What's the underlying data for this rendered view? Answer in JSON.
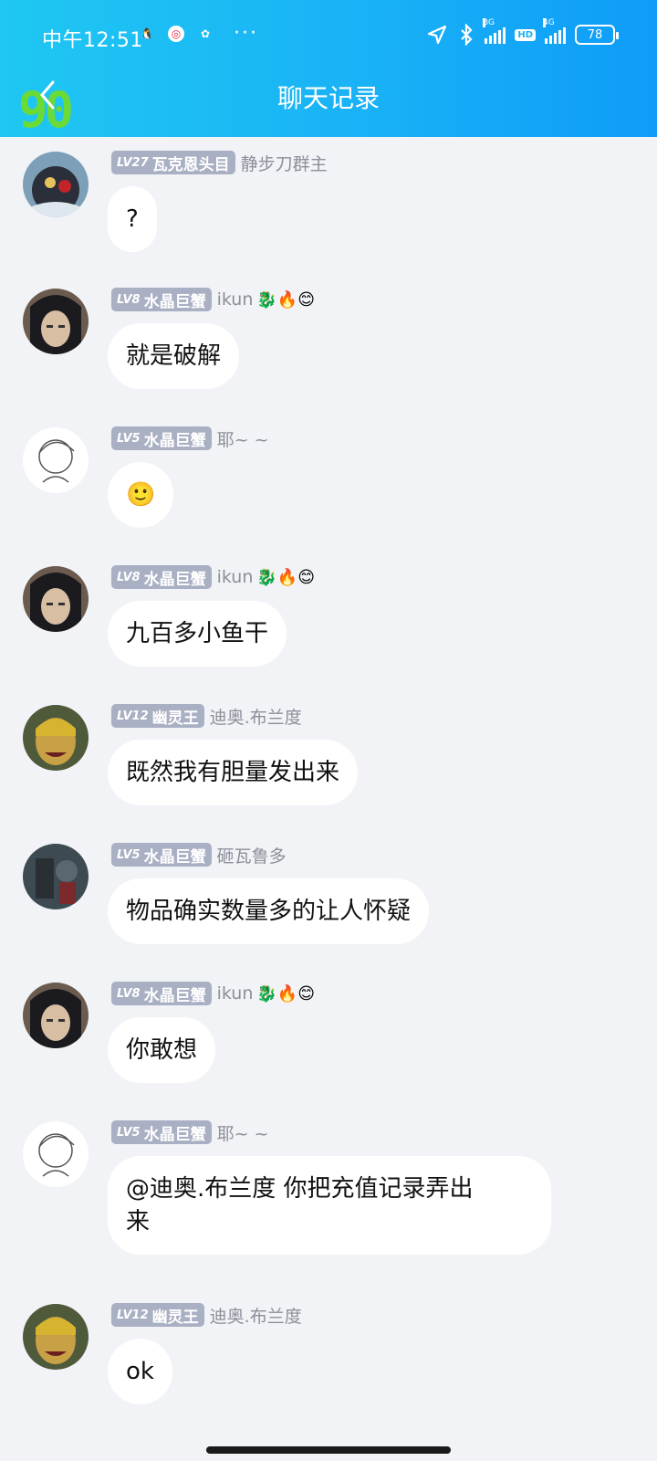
{
  "status_bar": {
    "time": "中午12:51",
    "net1": "3G",
    "hd": "HD",
    "net2": "4G",
    "battery": "78"
  },
  "header": {
    "title": "聊天记录",
    "logo": "90"
  },
  "messages": [
    {
      "level": "LV27",
      "rank": "瓦克恩头目",
      "nick": "静步刀群主",
      "text": "?",
      "emojis": ""
    },
    {
      "level": "LV8",
      "rank": "水晶巨蟹",
      "nick": "ikun",
      "text": "就是破解",
      "emojis": "🐉🔥😊"
    },
    {
      "level": "LV5",
      "rank": "水晶巨蟹",
      "nick": "耶~ ~",
      "text": "🙂",
      "emojis": ""
    },
    {
      "level": "LV8",
      "rank": "水晶巨蟹",
      "nick": "ikun",
      "text": "九百多小鱼干",
      "emojis": "🐉🔥😊"
    },
    {
      "level": "LV12",
      "rank": "幽灵王",
      "nick": "迪奥.布兰度",
      "text": "既然我有胆量发出来",
      "emojis": ""
    },
    {
      "level": "LV5",
      "rank": "水晶巨蟹",
      "nick": "砸瓦鲁多",
      "text": "物品确实数量多的让人怀疑",
      "emojis": ""
    },
    {
      "level": "LV8",
      "rank": "水晶巨蟹",
      "nick": "ikun",
      "text": "你敢想",
      "emojis": "🐉🔥😊"
    },
    {
      "level": "LV5",
      "rank": "水晶巨蟹",
      "nick": "耶~ ~",
      "text_line1": "@迪奥.布兰度 你把充值记录弄出",
      "text_line2": "来",
      "emojis": ""
    },
    {
      "level": "LV12",
      "rank": "幽灵王",
      "nick": "迪奥.布兰度",
      "text": "ok",
      "emojis": ""
    }
  ]
}
